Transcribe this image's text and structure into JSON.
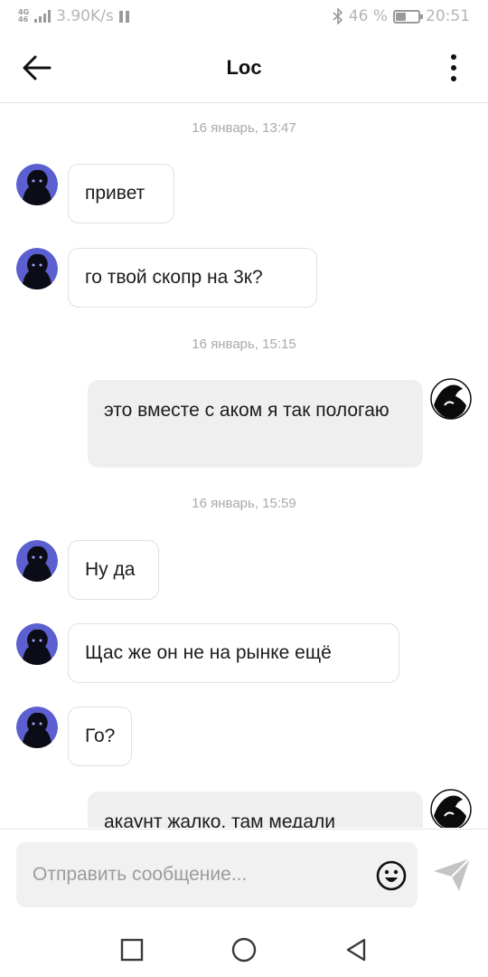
{
  "status_bar": {
    "network_type": "4G",
    "network_sub": "46",
    "speed": "3.90K/s",
    "battery_percent": "46 %",
    "battery_level": 0.46,
    "time": "20:51"
  },
  "header": {
    "title": "Loc"
  },
  "messages": [
    {
      "type": "date",
      "text": "16 январь, 13:47"
    },
    {
      "type": "incoming",
      "text": "привет"
    },
    {
      "type": "incoming",
      "text": "го твой скопр на 3к?"
    },
    {
      "type": "date",
      "text": "16 январь, 15:15"
    },
    {
      "type": "outgoing",
      "text": "это вместе с аком я так пологаю"
    },
    {
      "type": "date",
      "text": "16 январь, 15:59"
    },
    {
      "type": "incoming",
      "text": "Ну да"
    },
    {
      "type": "incoming",
      "text": "Щас же он не на рынке ещё"
    },
    {
      "type": "incoming",
      "text": "Го?"
    },
    {
      "type": "outgoing",
      "text": "акаунт жалко, там медали"
    }
  ],
  "composer": {
    "placeholder": "Отправить сообщение..."
  },
  "colors": {
    "avatar_incoming": "#5b5fd0",
    "bubble_outgoing": "#efefef",
    "divider": "#e2e2e2"
  },
  "icons": {
    "back": "arrow-left-icon",
    "menu": "vertical-dots-icon",
    "emoji": "smiley-icon",
    "send": "paper-plane-icon",
    "nav_recents": "square-icon",
    "nav_home": "circle-icon",
    "nav_back": "triangle-back-icon"
  }
}
